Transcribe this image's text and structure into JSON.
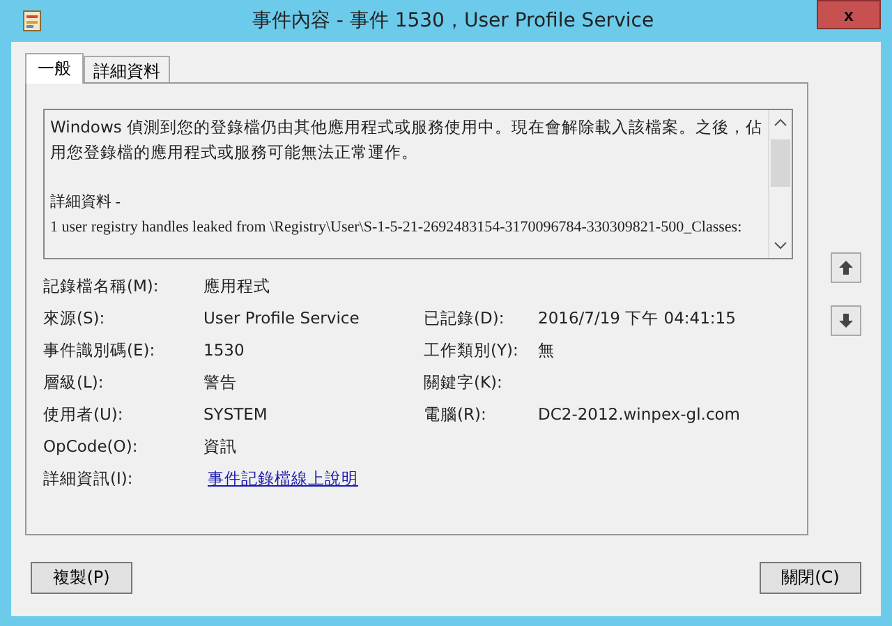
{
  "window": {
    "title": "事件內容 - 事件 1530，User Profile Service",
    "close": "x"
  },
  "tabs": [
    {
      "label": "一般",
      "selected": true
    },
    {
      "label": "詳細資料",
      "selected": false
    }
  ],
  "description": {
    "paragraphs": [
      "Windows 偵測到您的登錄檔仍由其他應用程式或服務使用中。現在會解除載入該檔案。之後，佔用您登錄檔的應用程式或服務可能無法正常運作。"
    ],
    "details": [
      " 詳細資料 -",
      " 1 user registry handles leaked from \\Registry\\User\\S-1-5-21-2692483154-3170096784-330309821-500_Classes:"
    ]
  },
  "fields": [
    {
      "label": "記錄檔名稱(M):",
      "value": "應用程式",
      "kind": "text"
    },
    {
      "label": "來源(S):",
      "value": "User Profile Service",
      "kind": "text",
      "label2": "已記錄(D):",
      "value2": "2016/7/19 下午 04:41:15"
    },
    {
      "label": "事件識別碼(E):",
      "value": "1530",
      "kind": "text",
      "label2": "工作類別(Y):",
      "value2": "無"
    },
    {
      "label": "層級(L):",
      "value": "警告",
      "kind": "text",
      "label2": "關鍵字(K):"
    },
    {
      "label": "使用者(U):",
      "value": "SYSTEM",
      "kind": "text",
      "label2": "電腦(R):",
      "value2": "DC2-2012.winpex-gl.com"
    },
    {
      "label": "OpCode(O):",
      "value": "資訊",
      "kind": "text"
    },
    {
      "label": "詳細資訊(I):",
      "value": "事件記錄檔線上說明",
      "kind": "link"
    }
  ],
  "buttons": [
    {
      "label": "複製(P)"
    },
    {
      "label": "關閉(C)"
    }
  ]
}
